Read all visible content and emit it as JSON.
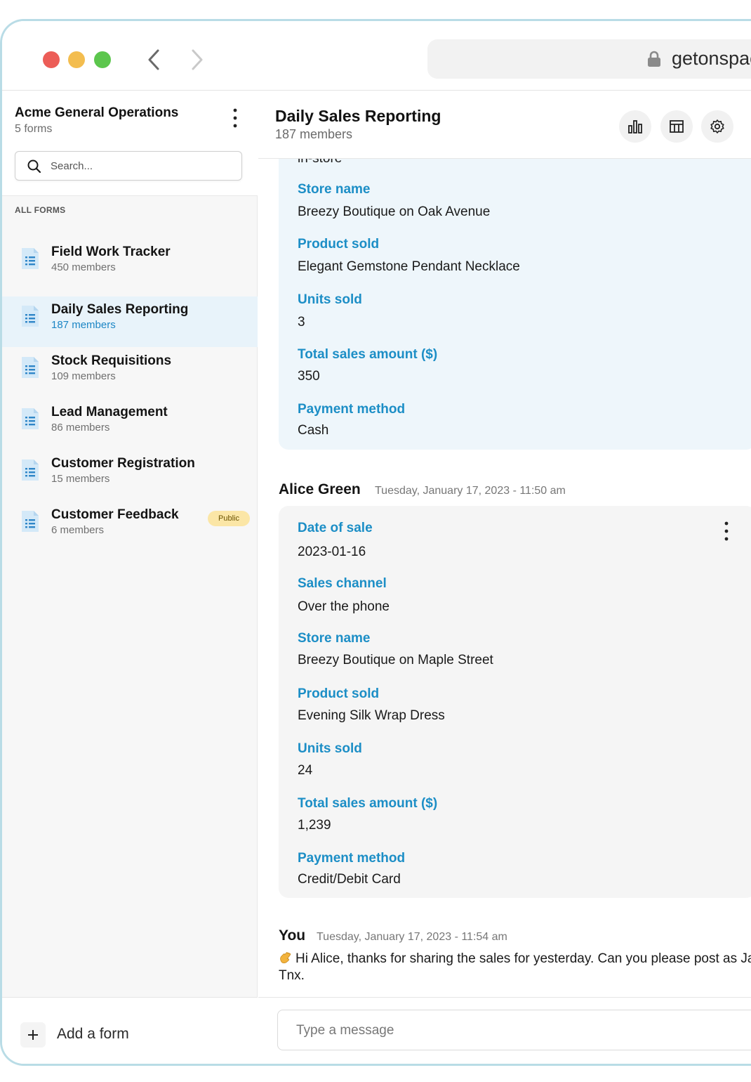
{
  "browser": {
    "url": "getonspac"
  },
  "workspace": {
    "name": "Acme General Operations",
    "forms_count": "5 forms",
    "search_placeholder": "Search...",
    "section_label": "ALL FORMS"
  },
  "forms": [
    {
      "title": "Field Work Tracker",
      "members": "450 members"
    },
    {
      "title": "Daily Sales Reporting",
      "members": "187 members",
      "active": true
    },
    {
      "title": "Stock Requisitions",
      "members": "109 members"
    },
    {
      "title": "Lead Management",
      "members": "86 members"
    },
    {
      "title": "Customer Registration",
      "members": "15 members"
    },
    {
      "title": "Customer Feedback",
      "members": "6 members",
      "badge": "Public"
    }
  ],
  "add_form_label": "Add a form",
  "main": {
    "title": "Daily Sales Reporting",
    "members": "187 members",
    "header_icons": [
      "bar-chart-icon",
      "table-icon",
      "gear-icon"
    ]
  },
  "entry_partial": {
    "clipped_value": "in-store",
    "fields": [
      {
        "label": "Store name",
        "value": "Breezy Boutique on Oak Avenue"
      },
      {
        "label": "Product sold",
        "value": "Elegant Gemstone Pendant Necklace"
      },
      {
        "label": "Units sold",
        "value": "3"
      },
      {
        "label": "Total sales amount ($)",
        "value": "350"
      },
      {
        "label": "Payment method",
        "value": "Cash"
      }
    ]
  },
  "entry_alice": {
    "author": "Alice Green",
    "timestamp": "Tuesday, January 17, 2023 - 11:50 am",
    "fields": [
      {
        "label": "Date of sale",
        "value": "2023-01-16"
      },
      {
        "label": "Sales channel",
        "value": "Over the phone"
      },
      {
        "label": "Store name",
        "value": "Breezy Boutique on Maple Street"
      },
      {
        "label": "Product sold",
        "value": "Evening Silk Wrap Dress"
      },
      {
        "label": "Units sold",
        "value": "24"
      },
      {
        "label": "Total sales amount ($)",
        "value": "1,239"
      },
      {
        "label": "Payment method",
        "value": "Credit/Debit Card"
      }
    ]
  },
  "message_you": {
    "author": "You",
    "timestamp": "Tuesday, January 17, 2023 - 11:54 am",
    "text": "Hi Alice, thanks for sharing the sales for yesterday. Can you please post as Jan? Tnx."
  },
  "composer": {
    "placeholder": "Type a message"
  },
  "colors": {
    "accent": "#1c8ec6",
    "active_item_bg": "#e8f3fa",
    "badge_bg": "#fbe6a6"
  }
}
